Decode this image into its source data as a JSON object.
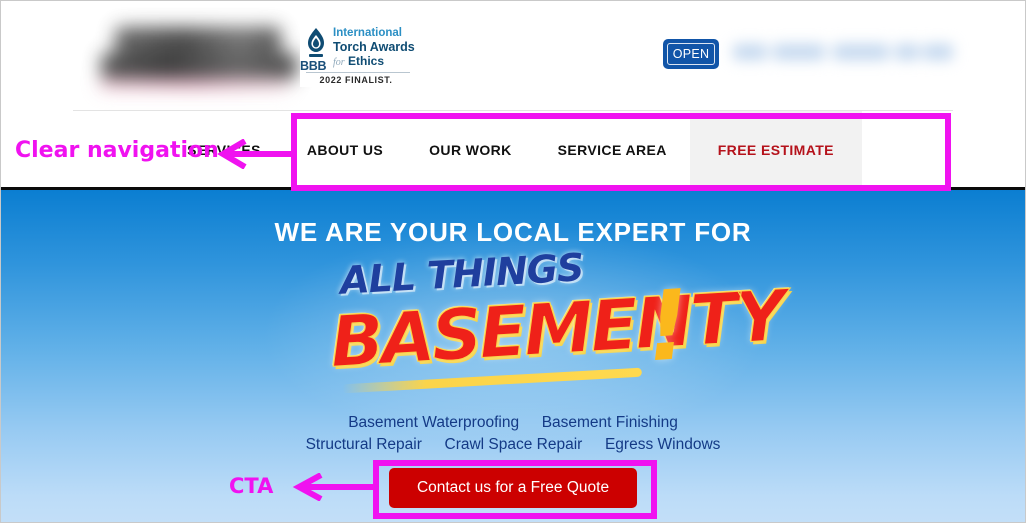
{
  "header": {
    "logo_alt": "company-logo-blurred",
    "badge": {
      "bbb": "BBB",
      "line1": "International",
      "line2": "Torch Awards",
      "line3_for": "for",
      "line3_main": "Ethics",
      "finalist": "2022 FINALIST."
    },
    "open_button_label": "OPEN",
    "phone_alt": "phone-number-blurred"
  },
  "nav": {
    "items": [
      {
        "label": "SERVICES",
        "highlight": false
      },
      {
        "label": "ABOUT US",
        "highlight": false
      },
      {
        "label": "OUR WORK",
        "highlight": false
      },
      {
        "label": "SERVICE AREA",
        "highlight": false
      },
      {
        "label": "FREE ESTIMATE",
        "highlight": true
      }
    ]
  },
  "hero": {
    "headline": "WE ARE YOUR LOCAL EXPERT FOR",
    "logo": {
      "top_line": "ALL THINGS",
      "main_word": "BASEMENTY",
      "bang": "!"
    },
    "services_row1": [
      "Basement Waterproofing",
      "Basement Finishing"
    ],
    "services_row2": [
      "Structural Repair",
      "Crawl Space Repair",
      "Egress Windows"
    ],
    "cta_label": "Contact us for a Free Quote"
  },
  "annotations": {
    "nav_label": "Clear navigation",
    "cta_label": "CTA",
    "color": "#f012f0"
  },
  "colors": {
    "accent_blue": "#0b7ed1",
    "hero_gradient_bottom": "#c3dff8",
    "cta_red": "#cc0000",
    "free_estimate_red": "#b5121b",
    "free_estimate_bg": "#f2f2f2",
    "open_button_blue": "#1155a8",
    "service_link": "#143a86",
    "logo_blue": "#1f3f9e",
    "logo_red": "#ef2119",
    "logo_yellow": "#fbb81c"
  }
}
